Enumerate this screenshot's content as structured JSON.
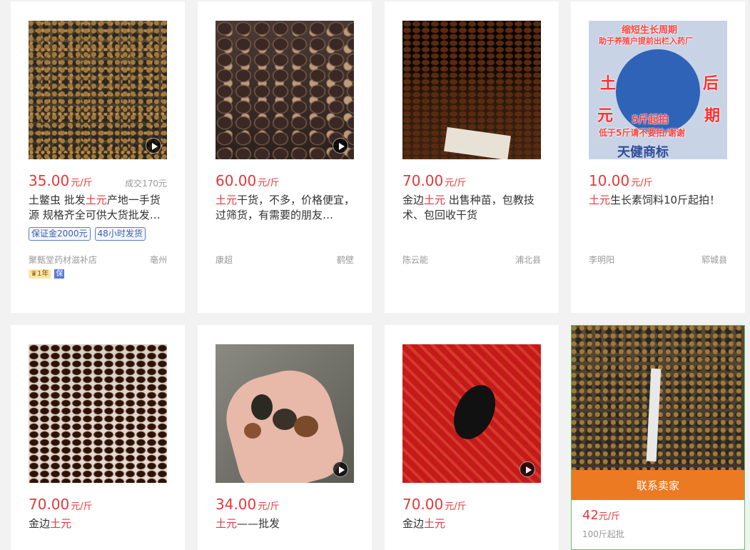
{
  "products": [
    {
      "price": "35.00",
      "unit": "元/斤",
      "sold": "成交170元",
      "title_parts": [
        {
          "t": "土鳖虫 批发"
        },
        {
          "t": "土元",
          "hl": true
        },
        {
          "t": "产地一手货源 规格齐全可供大货批发…"
        }
      ],
      "tags": [
        "保证金2000元",
        "48小时发货"
      ],
      "seller": "聚甄堂药材滋补店",
      "location": "亳州",
      "badge_year": "1年",
      "badge_bao": "保",
      "video": true
    },
    {
      "price": "60.00",
      "unit": "元/斤",
      "sold": "",
      "title_parts": [
        {
          "t": "土元",
          "hl": true
        },
        {
          "t": "干货，不多，价格便宜，过筛货，有需要的朋友…"
        }
      ],
      "tags": [],
      "seller": "康超",
      "location": "鹤壁",
      "video": true
    },
    {
      "price": "70.00",
      "unit": "元/斤",
      "sold": "",
      "title_parts": [
        {
          "t": "金边"
        },
        {
          "t": "土元",
          "hl": true
        },
        {
          "t": " 出售种苗，包教技术、包回收干货"
        }
      ],
      "tags": [],
      "seller": "陈云能",
      "location": "浦北县",
      "video": false
    },
    {
      "price": "10.00",
      "unit": "元/斤",
      "sold": "",
      "title_parts": [
        {
          "t": "土元",
          "hl": true
        },
        {
          "t": "生长素饲料10斤起拍！"
        }
      ],
      "tags": [],
      "seller": "李明阳",
      "location": "郓城县",
      "video": false,
      "poster": {
        "top": "缩短生长周期",
        "sub": "助于养殖户提前出栏入药厂",
        "left1": "土",
        "left2": "元",
        "right1": "后",
        "right2": "期",
        "mid1": "5斤起拍",
        "mid2": "低于5斤请不要拍/谢谢",
        "bottom": "天健商标"
      }
    },
    {
      "price": "70.00",
      "unit": "元/斤",
      "title_parts": [
        {
          "t": "金边"
        },
        {
          "t": "土元",
          "hl": true
        }
      ],
      "video": false
    },
    {
      "price": "34.00",
      "unit": "元/斤",
      "title_parts": [
        {
          "t": "土元",
          "hl": true
        },
        {
          "t": "——批发"
        }
      ],
      "video": true
    },
    {
      "price": "70.00",
      "unit": "元/斤",
      "title_parts": [
        {
          "t": "金边"
        },
        {
          "t": "土元",
          "hl": true
        }
      ],
      "video": true
    },
    {
      "price": "42",
      "unit": "元/斤",
      "moq": "100斤起批",
      "contact": "联系卖家"
    }
  ],
  "colors": {
    "price": "#e4393c",
    "contact_bg": "#ec7a23",
    "hover_border": "#63c26b"
  }
}
